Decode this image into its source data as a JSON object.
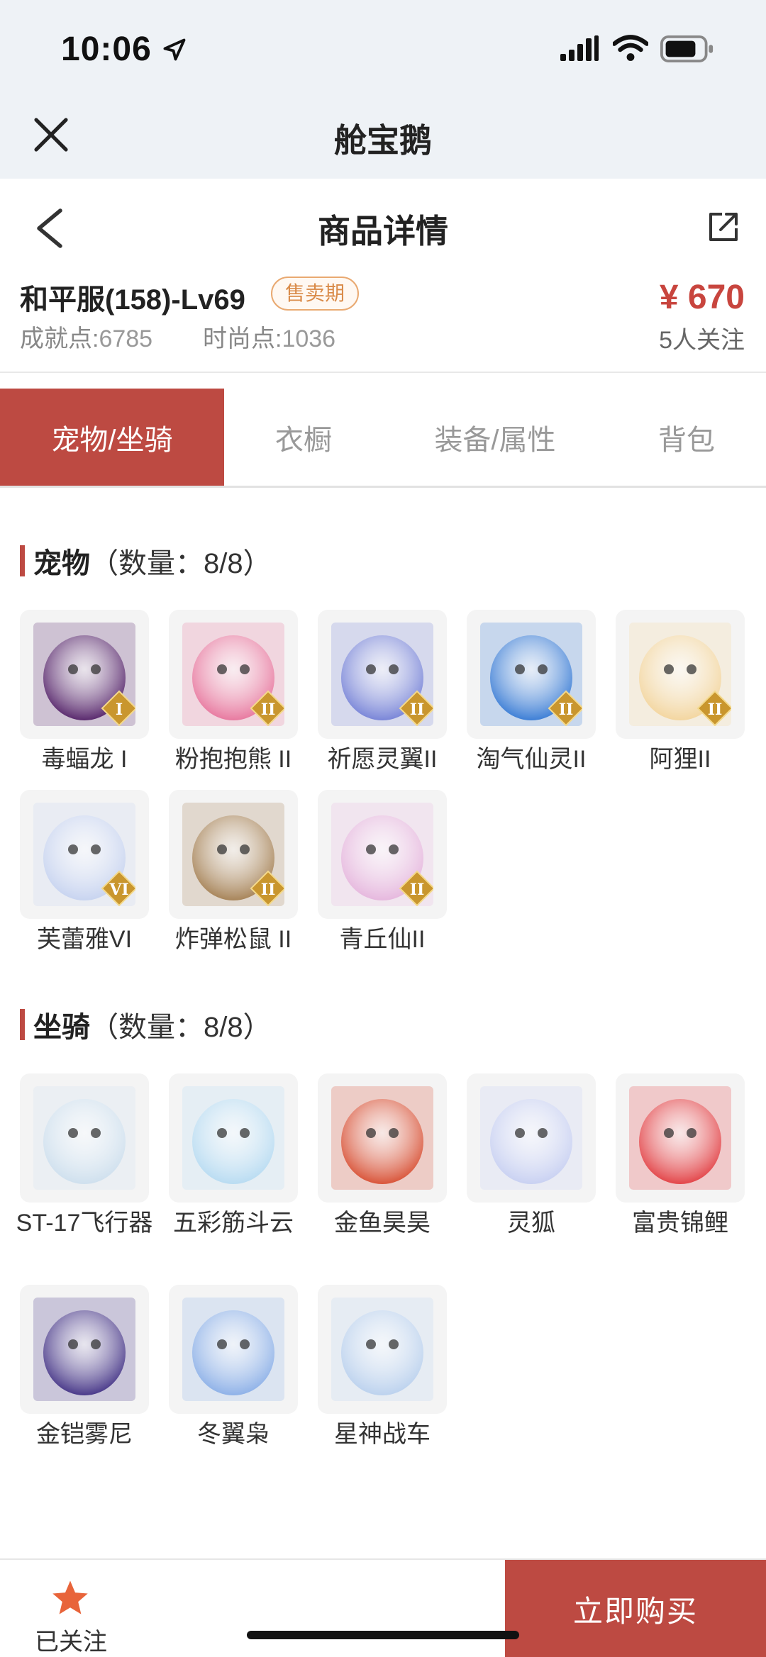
{
  "status": {
    "time": "10:06"
  },
  "app": {
    "title": "舱宝鹅"
  },
  "header": {
    "title": "商品详情"
  },
  "product": {
    "name": "和平服(158)-Lv69",
    "badge": "售卖期",
    "achievement_label": "成就点:",
    "achievement_value": "6785",
    "fashion_label": "时尚点:",
    "fashion_value": "1036",
    "price": "¥ 670",
    "followers": "5人关注"
  },
  "tabs": [
    {
      "label": "宠物/坐骑",
      "active": true
    },
    {
      "label": "衣橱",
      "active": false
    },
    {
      "label": "装备/属性",
      "active": false
    },
    {
      "label": "背包",
      "active": false
    }
  ],
  "pets": {
    "title": "宠物",
    "count": "（数量：8/8）",
    "items": [
      {
        "name": "毒蝠龙 I",
        "color": "#5a2a6e",
        "tier": "I"
      },
      {
        "name": "粉抱抱熊 II",
        "color": "#e87aa0",
        "tier": "II"
      },
      {
        "name": "祈愿灵翼II",
        "color": "#7a86d8",
        "tier": "II"
      },
      {
        "name": "淘气仙灵II",
        "color": "#3e7fd6",
        "tier": "II"
      },
      {
        "name": "阿狸II",
        "color": "#f3d6a0",
        "tier": "II"
      },
      {
        "name": "芙蕾雅VI",
        "color": "#c8d4f0",
        "tier": "VI"
      },
      {
        "name": "炸弹松鼠 II",
        "color": "#a8855a",
        "tier": "II"
      },
      {
        "name": "青丘仙II",
        "color": "#e6b8de",
        "tier": "II"
      }
    ]
  },
  "mounts": {
    "title": "坐骑",
    "count": "（数量：8/8）",
    "items": [
      {
        "name": "ST-17飞行器",
        "color": "#cfe0ee"
      },
      {
        "name": "五彩筋斗云",
        "color": "#b9dcf2"
      },
      {
        "name": "金鱼昊昊",
        "color": "#d9553a"
      },
      {
        "name": "灵狐",
        "color": "#c9d1f2"
      },
      {
        "name": "富贵锦鲤",
        "color": "#e3464a"
      },
      {
        "name": "金铠雾尼",
        "color": "#4a3a8a"
      },
      {
        "name": "冬翼枭",
        "color": "#8fb2e8"
      },
      {
        "name": "星神战车",
        "color": "#bcd2ee"
      }
    ]
  },
  "bottom": {
    "follow_label": "已关注",
    "buy_label": "立即购买"
  },
  "colors": {
    "accent": "#bd4a42",
    "badge": "#d98a48",
    "star": "#e8643a"
  }
}
